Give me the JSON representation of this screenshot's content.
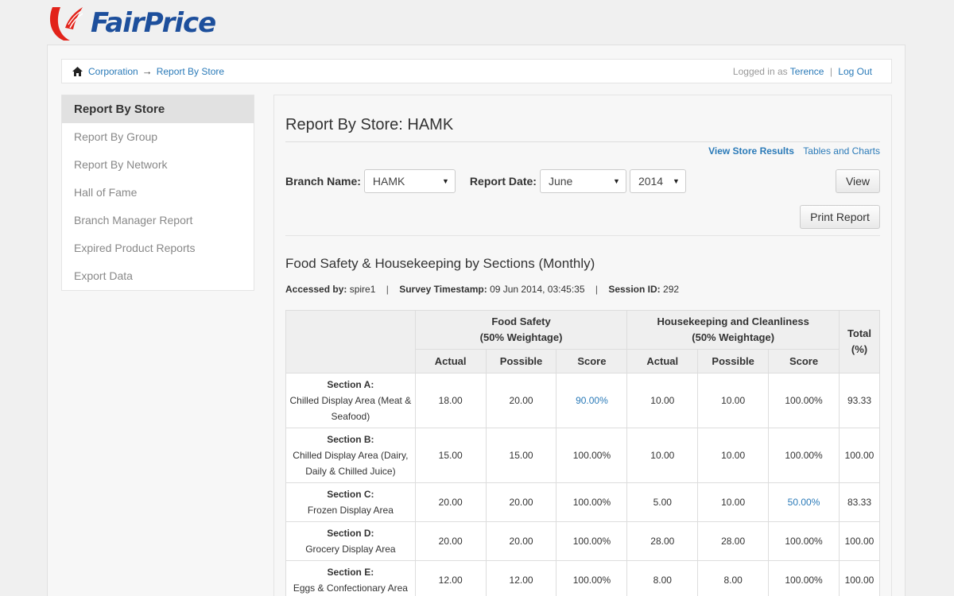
{
  "brand": {
    "name": "FairPrice"
  },
  "breadcrumb": {
    "home": "Corporation",
    "arrow": "→",
    "current": "Report By Store"
  },
  "user": {
    "prefix": "Logged in as",
    "name": "Terence",
    "separator": "|",
    "logout": "Log Out"
  },
  "sidebar": {
    "items": [
      {
        "label": "Report By Store",
        "active": true
      },
      {
        "label": "Report By Group"
      },
      {
        "label": "Report By Network"
      },
      {
        "label": "Hall of Fame"
      },
      {
        "label": "Branch Manager Report"
      },
      {
        "label": "Expired Product Reports"
      },
      {
        "label": "Export Data"
      }
    ]
  },
  "main": {
    "title": "Report By Store: HAMK",
    "links": {
      "store_results": "View Store Results",
      "tables_charts": "Tables and Charts"
    },
    "filters": {
      "branch_label": "Branch Name:",
      "branch_value": "HAMK",
      "date_label": "Report Date:",
      "month_value": "June",
      "year_value": "2014",
      "view_button": "View",
      "print_button": "Print Report"
    },
    "section_title": "Food Safety & Housekeeping by Sections (Monthly)",
    "meta": {
      "accessed_label": "Accessed by:",
      "accessed_value": "spire1",
      "timestamp_label": "Survey Timestamp:",
      "timestamp_value": "09 Jun 2014, 03:45:35",
      "session_label": "Session ID:",
      "session_value": "292",
      "pipe": "|"
    },
    "table": {
      "food_header": "Food Safety",
      "food_weight": "(50% Weightage)",
      "house_header": "Housekeeping and Cleanliness",
      "house_weight": "(50% Weightage)",
      "total_header": "Total",
      "total_unit": "(%)",
      "sub_actual": "Actual",
      "sub_possible": "Possible",
      "sub_score": "Score",
      "rows": [
        {
          "section": "Section A:",
          "area": "Chilled Display Area (Meat & Seafood)",
          "fs_actual": "18.00",
          "fs_possible": "20.00",
          "fs_score": "90.00%",
          "hk_actual": "10.00",
          "hk_possible": "10.00",
          "hk_score": "100.00%",
          "total": "93.33"
        },
        {
          "section": "Section B:",
          "area": "Chilled Display Area (Dairy, Daily & Chilled Juice)",
          "fs_actual": "15.00",
          "fs_possible": "15.00",
          "fs_score": "100.00%",
          "hk_actual": "10.00",
          "hk_possible": "10.00",
          "hk_score": "100.00%",
          "total": "100.00"
        },
        {
          "section": "Section C:",
          "area": "Frozen Display Area",
          "fs_actual": "20.00",
          "fs_possible": "20.00",
          "fs_score": "100.00%",
          "hk_actual": "5.00",
          "hk_possible": "10.00",
          "hk_score": "50.00%",
          "total": "83.33"
        },
        {
          "section": "Section D:",
          "area": "Grocery Display Area",
          "fs_actual": "20.00",
          "fs_possible": "20.00",
          "fs_score": "100.00%",
          "hk_actual": "28.00",
          "hk_possible": "28.00",
          "hk_score": "100.00%",
          "total": "100.00"
        },
        {
          "section": "Section E:",
          "area": "Eggs & Confectionary Area",
          "fs_actual": "12.00",
          "fs_possible": "12.00",
          "fs_score": "100.00%",
          "hk_actual": "8.00",
          "hk_possible": "8.00",
          "hk_score": "100.00%",
          "total": "100.00"
        }
      ]
    }
  },
  "colors": {
    "link": "#2a7ab8",
    "brand_blue": "#1d4f9c",
    "brand_red": "#e2231a"
  }
}
